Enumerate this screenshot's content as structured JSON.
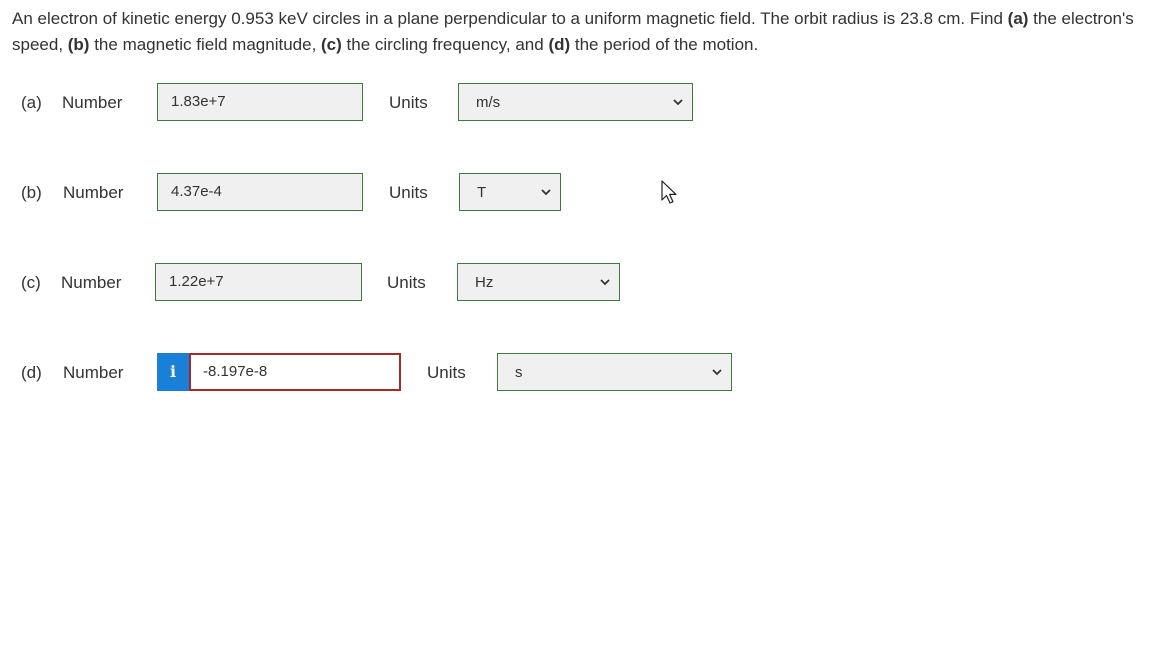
{
  "question": {
    "intro": "An electron of kinetic energy 0.953 keV circles in a plane perpendicular to a uniform magnetic field. The orbit radius is 23.8 cm. Find ",
    "a_marker": "(a)",
    "a_text": " the electron's speed, ",
    "b_marker": "(b)",
    "b_text": " the magnetic field magnitude, ",
    "c_marker": "(c)",
    "c_text": " the circling frequency, and ",
    "d_marker": "(d)",
    "d_text": " the period of the motion."
  },
  "number_label": "Number",
  "units_label": "Units",
  "parts": [
    {
      "label": "(a)",
      "value": "1.83e+7",
      "unit": "m/s"
    },
    {
      "label": "(b)",
      "value": "4.37e-4",
      "unit": "T"
    },
    {
      "label": "(c)",
      "value": "1.22e+7",
      "unit": "Hz"
    },
    {
      "label": "(d)",
      "value": "-8.197e-8",
      "unit": "s",
      "info_icon": "i"
    }
  ],
  "colors": {
    "correct_border": "#3d7a3d",
    "error_border": "#a52a2a",
    "info_badge": "#1a7fd6"
  },
  "icons": {
    "select_arrow": "chevron-down-icon",
    "info": "info-icon",
    "cursor": "mouse-pointer-icon"
  }
}
